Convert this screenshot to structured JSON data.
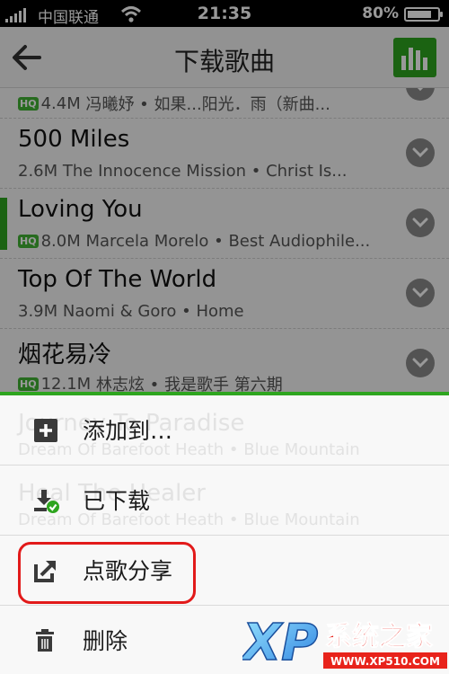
{
  "status_bar": {
    "carrier": "中国联通",
    "time": "21:35",
    "battery_percent": "80%",
    "battery_level": 0.8,
    "icons": [
      "signal-icon",
      "wifi-icon",
      "battery-icon"
    ]
  },
  "header": {
    "title": "下载歌曲",
    "back_icon": "back-arrow-icon",
    "equalizer_icon": "equalizer-icon",
    "accent_color": "#2ea51f"
  },
  "songs": [
    {
      "name": "",
      "hq": true,
      "size": "4.4M",
      "info": "冯曦妤 • 如果...阳光．雨（新曲...",
      "playing": false
    },
    {
      "name": "500 Miles",
      "hq": false,
      "size": "2.6M",
      "info": "The Innocence Mission • Christ Is...",
      "playing": false
    },
    {
      "name": "Loving You",
      "hq": true,
      "size": "8.0M",
      "info": "Marcela Morelo • Best Audiophile...",
      "playing": true
    },
    {
      "name": "Top Of The World",
      "hq": false,
      "size": "3.9M",
      "info": "Naomi & Goro • Home",
      "playing": false
    },
    {
      "name": "烟花易冷",
      "hq": true,
      "size": "12.1M",
      "info": "林志炫 • 我是歌手 第六期",
      "playing": false
    }
  ],
  "hq_badge": "HQ",
  "background_songs": [
    {
      "name": "Journey To Paradise",
      "meta": "Dream Of Barefoot Heath • Blue Mountain"
    },
    {
      "name": "Heal The Healer",
      "meta": "Dream Of Barefoot Heath • Blue Mountain"
    },
    {
      "name": "",
      "meta": ""
    },
    {
      "name": "",
      "meta": ""
    }
  ],
  "action_sheet": {
    "items": [
      {
        "label": "添加到…",
        "icon": "add-icon"
      },
      {
        "label": "已下载",
        "icon": "downloaded-icon"
      },
      {
        "label": "点歌分享",
        "icon": "share-icon"
      },
      {
        "label": "删除",
        "icon": "trash-icon"
      }
    ],
    "highlight_color": "#e21a1a"
  },
  "watermark": {
    "logo_text": "XP",
    "site_name": "系统之家",
    "url": "WWW.XP510.COM"
  }
}
